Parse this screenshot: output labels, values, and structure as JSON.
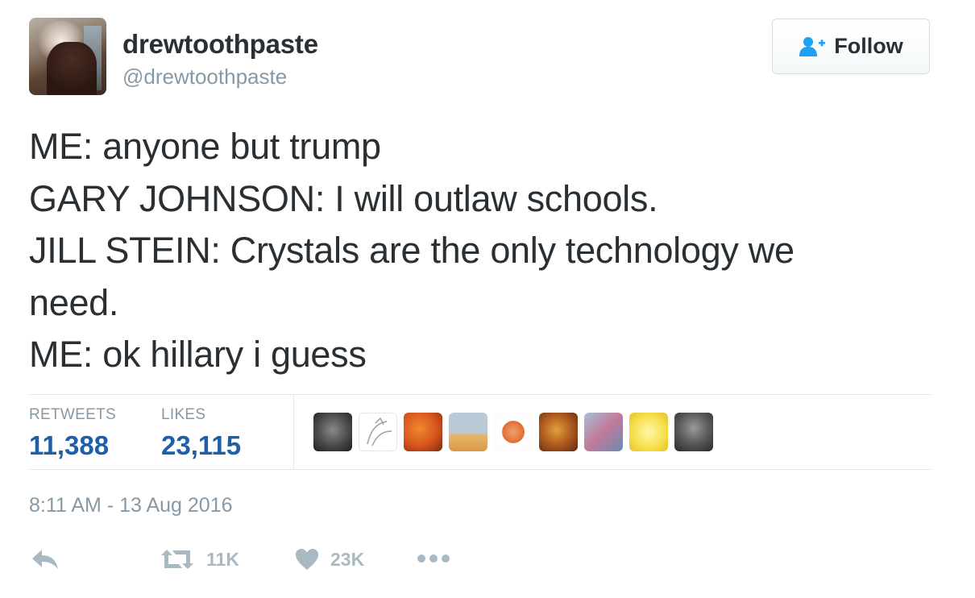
{
  "user": {
    "display_name": "drewtoothpaste",
    "handle": "@drewtoothpaste"
  },
  "follow_button": {
    "label": "Follow"
  },
  "tweet": {
    "lines": [
      "ME: anyone but trump",
      "GARY JOHNSON: I will outlaw schools.",
      "JILL STEIN: Crystals are the only technology we",
      "need.",
      "ME: ok hillary i guess"
    ]
  },
  "stats": {
    "retweets_label": "RETWEETS",
    "retweets_value": "11,388",
    "likes_label": "LIKES",
    "likes_value": "23,115"
  },
  "likers": [
    {
      "name": "wolf-avatar"
    },
    {
      "name": "sketch-avatar"
    },
    {
      "name": "fox-orange-avatar"
    },
    {
      "name": "laptop-cat-avatar"
    },
    {
      "name": "fox-sketch-avatar"
    },
    {
      "name": "lion-avatar"
    },
    {
      "name": "cartoon-avatar"
    },
    {
      "name": "yellow-cartoon-avatar"
    },
    {
      "name": "bald-man-avatar"
    }
  ],
  "timestamp": "8:11 AM - 13 Aug 2016",
  "actions": {
    "retweet_count": "11K",
    "like_count": "23K"
  },
  "colors": {
    "text": "#292f33",
    "muted": "#8899a6",
    "stat_value": "#1f5ea8",
    "icon": "#aab8c2",
    "follow_icon": "#1da1f2"
  }
}
